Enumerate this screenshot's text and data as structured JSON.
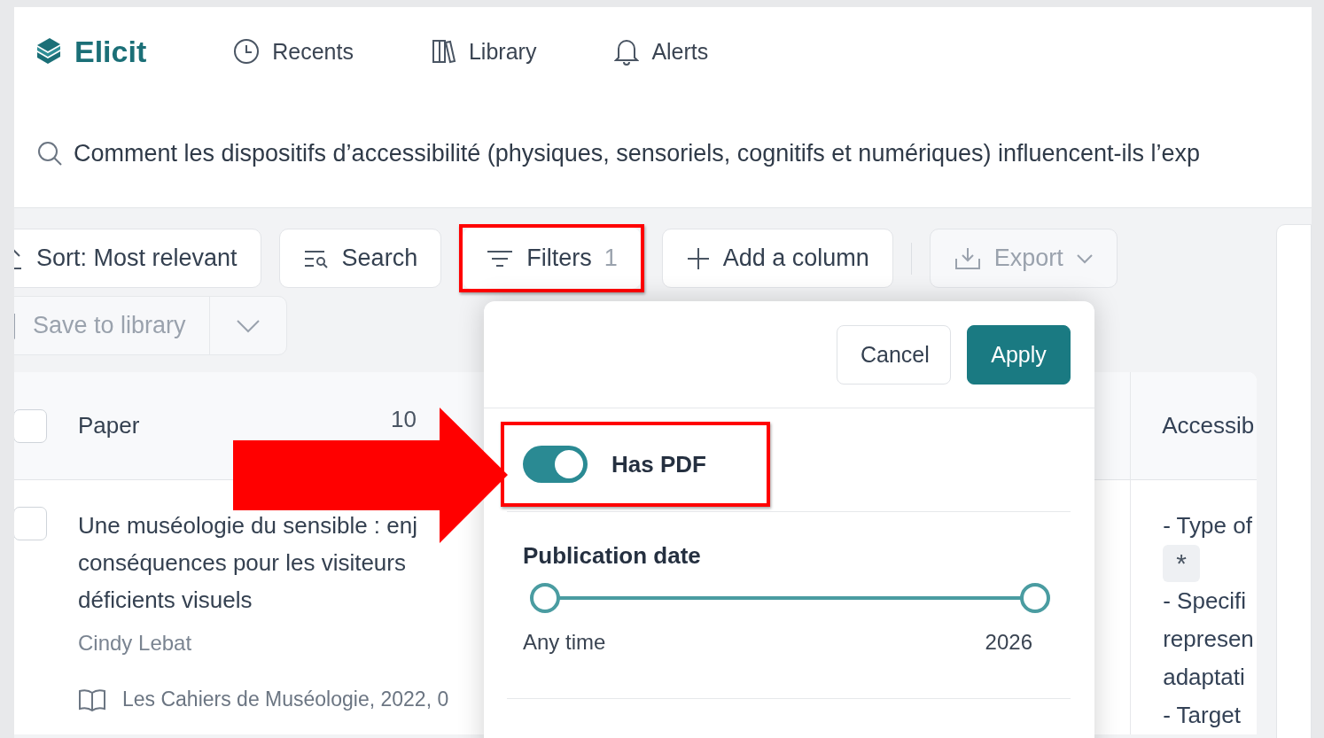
{
  "app": {
    "logo": "Elicit"
  },
  "nav": [
    {
      "label": "Recents"
    },
    {
      "label": "Library"
    },
    {
      "label": "Alerts"
    }
  ],
  "query": "Comment les dispositifs d’accessibilité (physiques, sensoriels, cognitifs et numériques) influencent-ils l’exp",
  "toolbar": [
    {
      "label": "Sort: Most relevant",
      "kind": "sort",
      "disabled": false,
      "highlighted": false
    },
    {
      "label": "Search",
      "kind": "search",
      "disabled": false,
      "highlighted": false
    },
    {
      "label": "Filters",
      "kind": "filters",
      "count": "1",
      "disabled": false,
      "highlighted": true
    },
    {
      "label": "Add a column",
      "kind": "add",
      "disabled": false,
      "highlighted": false
    },
    {
      "label": "Export",
      "kind": "export",
      "disabled": true,
      "highlighted": false
    }
  ],
  "save_to_library": {
    "label": "Save to library",
    "disabled": true
  },
  "table": {
    "header_checked": false,
    "columns": [
      {
        "label": "Paper",
        "count": "10"
      },
      {
        "label": "Accessib"
      }
    ],
    "rows": [
      {
        "checked": false,
        "title": "Une muséologie du sensible : enj\nconséquences pour les visiteurs\ndéficients visuels",
        "authors": "Cindy Lebat",
        "source": "Les Cahiers de Muséologie, 2022, 0",
        "column_2": [
          {
            "kind": "text",
            "text": "- Type of"
          },
          {
            "kind": "chip",
            "text": "*"
          },
          {
            "kind": "text",
            "text": "- Specifi"
          },
          {
            "kind": "text",
            "text": "represen"
          },
          {
            "kind": "text",
            "text": "adaptati"
          },
          {
            "kind": "text",
            "text": "- Target"
          }
        ]
      }
    ]
  },
  "filters_panel": {
    "buttons": [
      {
        "label": "Cancel",
        "kind": "secondary"
      },
      {
        "label": "Apply",
        "kind": "primary"
      }
    ],
    "has_pdf": {
      "label": "Has PDF",
      "on": true,
      "highlighted": true
    },
    "publication_date": {
      "title": "Publication date",
      "thumbs": [
        {
          "level": 0
        },
        {
          "level": 1
        }
      ],
      "min_label": "Any time",
      "max_label": "2026"
    }
  }
}
